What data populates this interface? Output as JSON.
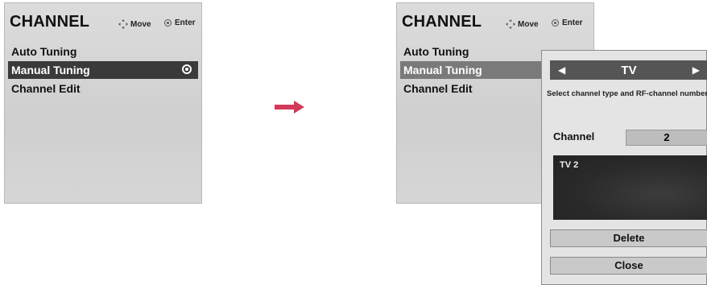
{
  "left_panel": {
    "title": "CHANNEL",
    "hint_move": "Move",
    "hint_enter": "Enter",
    "items": [
      {
        "label": "Auto Tuning"
      },
      {
        "label": "Manual Tuning",
        "selected": true
      },
      {
        "label": "Channel Edit"
      }
    ]
  },
  "right_panel": {
    "title": "CHANNEL",
    "hint_move": "Move",
    "hint_enter": "Enter",
    "items": [
      {
        "label": "Auto Tuning"
      },
      {
        "label": "Manual Tuning",
        "selected": true
      },
      {
        "label": "Channel Edit"
      }
    ]
  },
  "popup": {
    "type": "TV",
    "instruction": "Select channel type and RF-channel number.",
    "channel_label": "Channel",
    "channel_value": "2",
    "preview_label": "TV 2",
    "delete_label": "Delete",
    "close_label": "Close"
  },
  "colors": {
    "arrow": "#d23a5a",
    "selected_bg": "#3a3a3a",
    "panel_bg": "#d6d6d6"
  }
}
